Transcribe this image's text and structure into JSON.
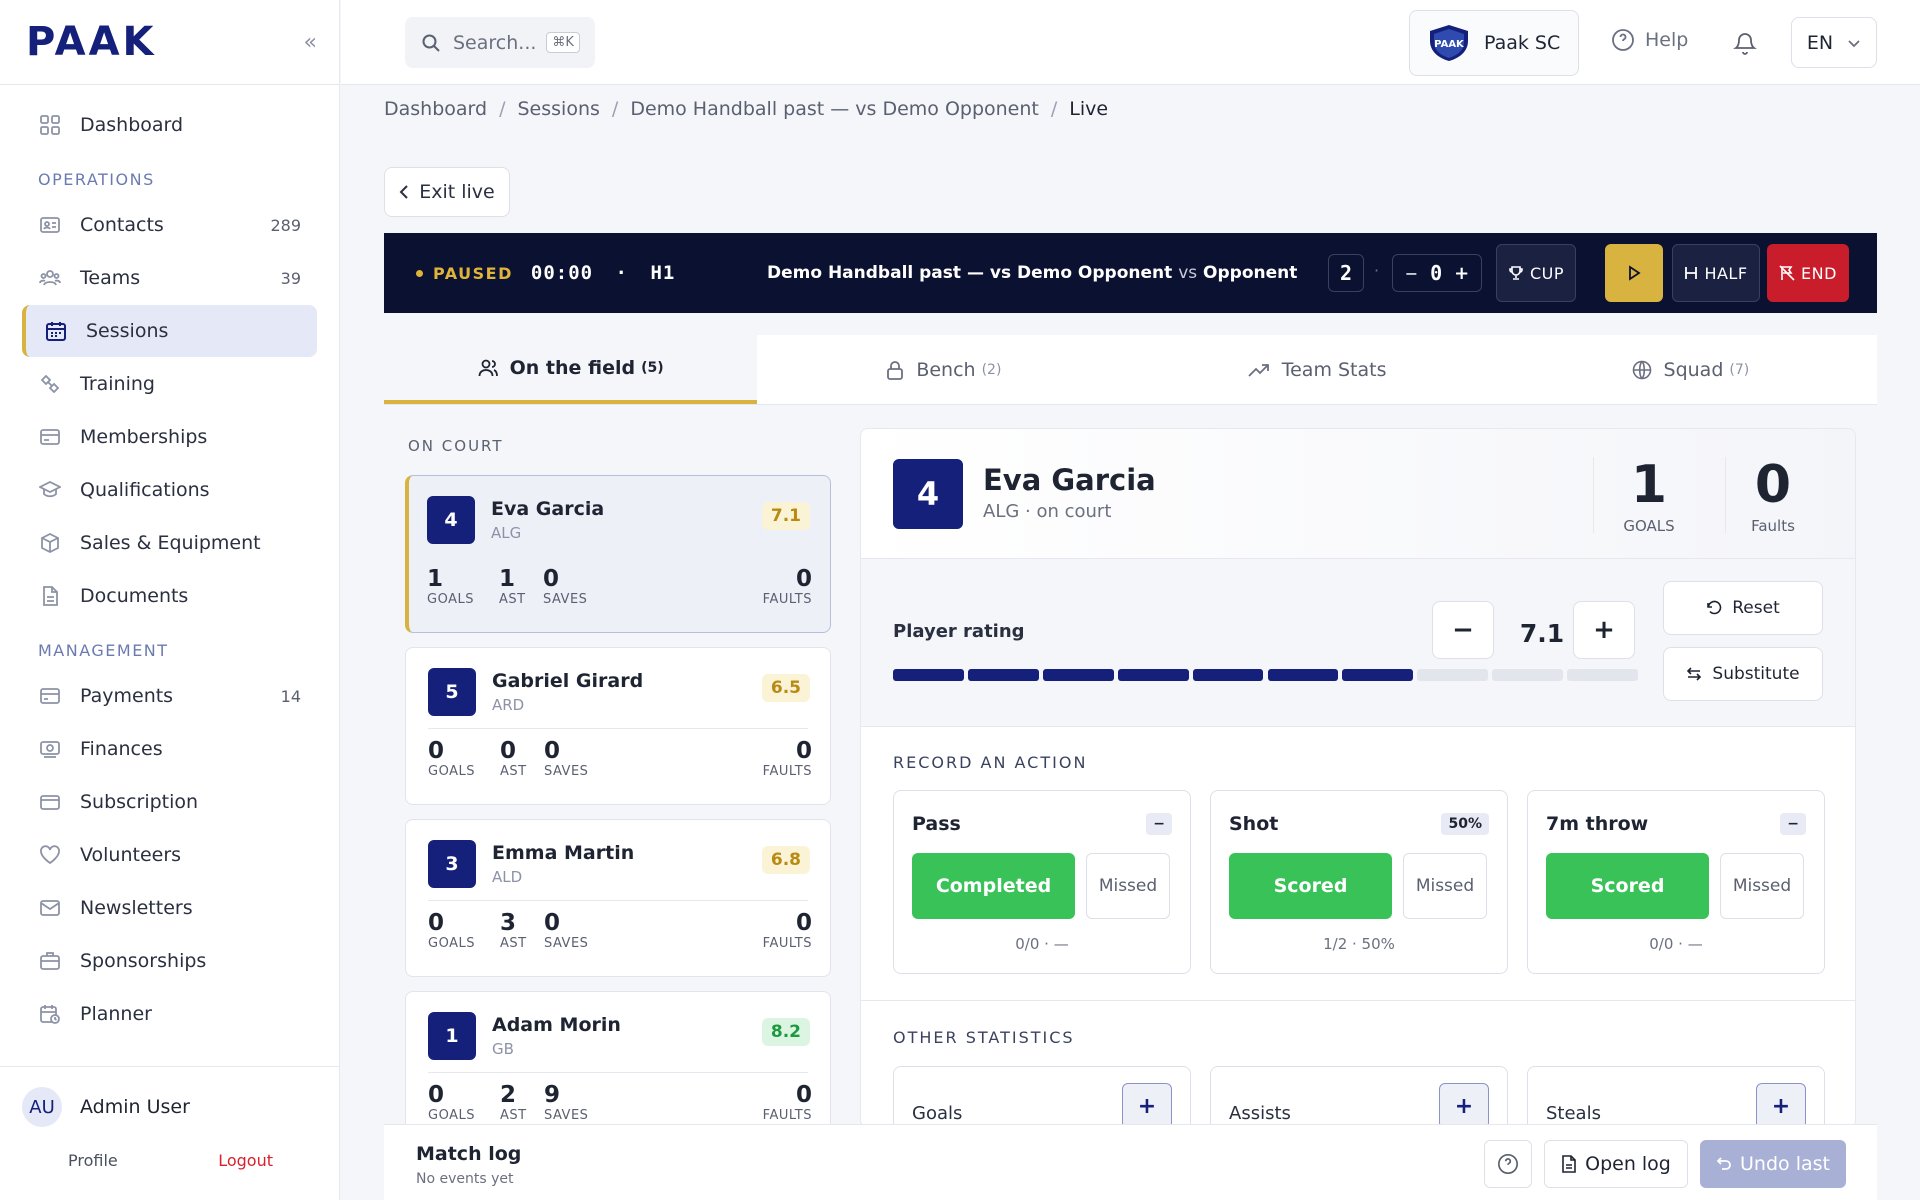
{
  "sidebar": {
    "logo": "PAAK",
    "nav_top": [
      {
        "label": "Dashboard",
        "icon": "grid-icon"
      }
    ],
    "operations_title": "OPERATIONS",
    "operations": [
      {
        "label": "Contacts",
        "count": "289"
      },
      {
        "label": "Teams",
        "count": "39"
      },
      {
        "label": "Sessions",
        "count": ""
      },
      {
        "label": "Training",
        "count": ""
      },
      {
        "label": "Memberships",
        "count": ""
      },
      {
        "label": "Qualifications",
        "count": ""
      },
      {
        "label": "Sales & Equipment",
        "count": ""
      },
      {
        "label": "Documents",
        "count": ""
      }
    ],
    "management_title": "MANAGEMENT",
    "management": [
      {
        "label": "Payments",
        "count": "14"
      },
      {
        "label": "Finances",
        "count": ""
      },
      {
        "label": "Subscription",
        "count": ""
      },
      {
        "label": "Volunteers",
        "count": ""
      },
      {
        "label": "Newsletters",
        "count": ""
      },
      {
        "label": "Sponsorships",
        "count": ""
      },
      {
        "label": "Planner",
        "count": ""
      }
    ],
    "user": {
      "initials": "AU",
      "name": "Admin User",
      "profile": "Profile",
      "logout": "Logout"
    }
  },
  "topbar": {
    "search_placeholder": "Search...",
    "search_shortcut": "⌘K",
    "club": "Paak SC",
    "club_badge": "PAAK",
    "help": "Help",
    "lang": "EN"
  },
  "breadcrumb": [
    "Dashboard",
    "Sessions",
    "Demo Handball past — vs Demo Opponent",
    "Live"
  ],
  "exit_live": "Exit live",
  "livebar": {
    "status": "PAUSED",
    "clock": "00:00",
    "sep": "·",
    "half": "H1",
    "match": "Demo Handball past — vs Demo Opponent",
    "vs_word": "vs",
    "opponent": "Opponent",
    "score_home": "2",
    "score_dot": "·",
    "minus": "−",
    "score_away": "0",
    "plus": "+",
    "cup": "CUP",
    "half_btn": "HALF",
    "end_btn": "END"
  },
  "tabs": [
    {
      "label": "On the field",
      "count": "(5)"
    },
    {
      "label": "Bench",
      "count": "(2)"
    },
    {
      "label": "Team Stats",
      "count": ""
    },
    {
      "label": "Squad",
      "count": "(7)"
    }
  ],
  "oncourt_label": "ON COURT",
  "stat_labels": {
    "goals": "GOALS",
    "ast": "AST",
    "saves": "SAVES",
    "faults": "FAULTS"
  },
  "players": [
    {
      "num": "4",
      "name": "Eva Garcia",
      "pos": "ALG",
      "rating": "7.1",
      "goals": "1",
      "ast": "1",
      "saves": "0",
      "faults": "0"
    },
    {
      "num": "5",
      "name": "Gabriel Girard",
      "pos": "ARD",
      "rating": "6.5",
      "goals": "0",
      "ast": "0",
      "saves": "0",
      "faults": "0"
    },
    {
      "num": "3",
      "name": "Emma Martin",
      "pos": "ALD",
      "rating": "6.8",
      "goals": "0",
      "ast": "3",
      "saves": "0",
      "faults": "0"
    },
    {
      "num": "1",
      "name": "Adam Morin",
      "pos": "GB",
      "rating": "8.2",
      "goals": "0",
      "ast": "2",
      "saves": "9",
      "faults": "0"
    }
  ],
  "detail": {
    "num": "4",
    "name": "Eva Garcia",
    "sub": "ALG · on court",
    "goals": "1",
    "goals_label": "GOALS",
    "faults": "0",
    "faults_label": "Faults",
    "rating_label": "Player rating",
    "rating_minus": "−",
    "rating_value": "7.1",
    "rating_plus": "+",
    "rating_fraction": 0.7,
    "reset": "Reset",
    "substitute": "Substitute",
    "record_label": "RECORD AN ACTION",
    "actions": [
      {
        "title": "Pass",
        "badge": "−",
        "ok": "Completed",
        "miss": "Missed",
        "summary": "0/0 · —"
      },
      {
        "title": "Shot",
        "badge": "50%",
        "ok": "Scored",
        "miss": "Missed",
        "summary": "1/2 · 50%"
      },
      {
        "title": "7m throw",
        "badge": "−",
        "ok": "Scored",
        "miss": "Missed",
        "summary": "0/0 · —"
      }
    ],
    "other_label": "OTHER STATISTICS",
    "others": [
      {
        "title": "Goals",
        "plus": "+"
      },
      {
        "title": "Assists",
        "plus": "+"
      },
      {
        "title": "Steals",
        "plus": "+"
      }
    ]
  },
  "footer": {
    "title": "Match log",
    "subtitle": "No events yet",
    "open_log": "Open log",
    "undo": "Undo last"
  },
  "colors": {
    "brand": "#14207a",
    "accent": "#d9b340",
    "success": "#38c258",
    "danger": "#c91d2b",
    "livebar": "#0b1130"
  }
}
